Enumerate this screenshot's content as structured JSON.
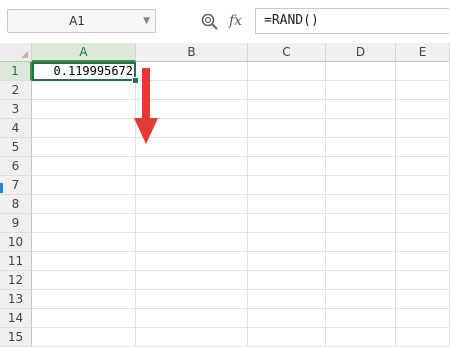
{
  "formula_bar": {
    "name_box": "A1",
    "fx_label": "fx",
    "formula": "=RAND()"
  },
  "columns": [
    "A",
    "B",
    "C",
    "D",
    "E"
  ],
  "rows": [
    "1",
    "2",
    "3",
    "4",
    "5",
    "6",
    "7",
    "8",
    "9",
    "10",
    "11",
    "12",
    "13",
    "14",
    "15"
  ],
  "active_cell": {
    "ref": "A1",
    "value": "0.119995672"
  },
  "colors": {
    "selection": "#217346",
    "arrow": "#e53935"
  },
  "icons": [
    "zoom-icon",
    "fx-icon",
    "dropdown-chevron-icon",
    "fill-arrow-icon"
  ]
}
